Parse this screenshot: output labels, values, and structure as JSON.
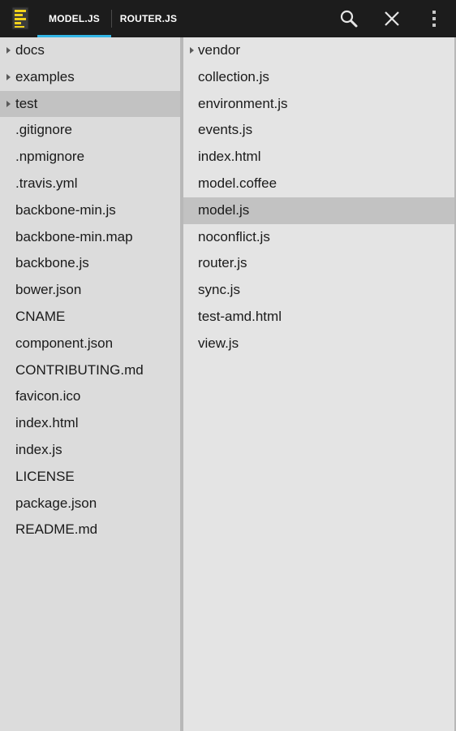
{
  "actionbar": {
    "tabs": [
      {
        "label": "MODEL.JS",
        "selected": true
      },
      {
        "label": "ROUTER.JS",
        "selected": false
      }
    ],
    "accent_color": "#33b5e5"
  },
  "left_panel": {
    "items": [
      {
        "label": "docs",
        "type": "folder"
      },
      {
        "label": "examples",
        "type": "folder"
      },
      {
        "label": "test",
        "type": "folder",
        "selected": true
      },
      {
        "label": ".gitignore",
        "type": "file"
      },
      {
        "label": ".npmignore",
        "type": "file"
      },
      {
        "label": ".travis.yml",
        "type": "file"
      },
      {
        "label": "backbone-min.js",
        "type": "file"
      },
      {
        "label": "backbone-min.map",
        "type": "file"
      },
      {
        "label": "backbone.js",
        "type": "file"
      },
      {
        "label": "bower.json",
        "type": "file"
      },
      {
        "label": "CNAME",
        "type": "file"
      },
      {
        "label": "component.json",
        "type": "file"
      },
      {
        "label": "CONTRIBUTING.md",
        "type": "file"
      },
      {
        "label": "favicon.ico",
        "type": "file"
      },
      {
        "label": "index.html",
        "type": "file"
      },
      {
        "label": "index.js",
        "type": "file"
      },
      {
        "label": "LICENSE",
        "type": "file"
      },
      {
        "label": "package.json",
        "type": "file"
      },
      {
        "label": "README.md",
        "type": "file"
      }
    ]
  },
  "right_panel": {
    "items": [
      {
        "label": "vendor",
        "type": "folder"
      },
      {
        "label": "collection.js",
        "type": "file"
      },
      {
        "label": "environment.js",
        "type": "file"
      },
      {
        "label": "events.js",
        "type": "file"
      },
      {
        "label": "index.html",
        "type": "file"
      },
      {
        "label": "model.coffee",
        "type": "file"
      },
      {
        "label": "model.js",
        "type": "file",
        "selected": true
      },
      {
        "label": "noconflict.js",
        "type": "file"
      },
      {
        "label": "router.js",
        "type": "file"
      },
      {
        "label": "sync.js",
        "type": "file"
      },
      {
        "label": "test-amd.html",
        "type": "file"
      },
      {
        "label": "view.js",
        "type": "file"
      }
    ]
  }
}
